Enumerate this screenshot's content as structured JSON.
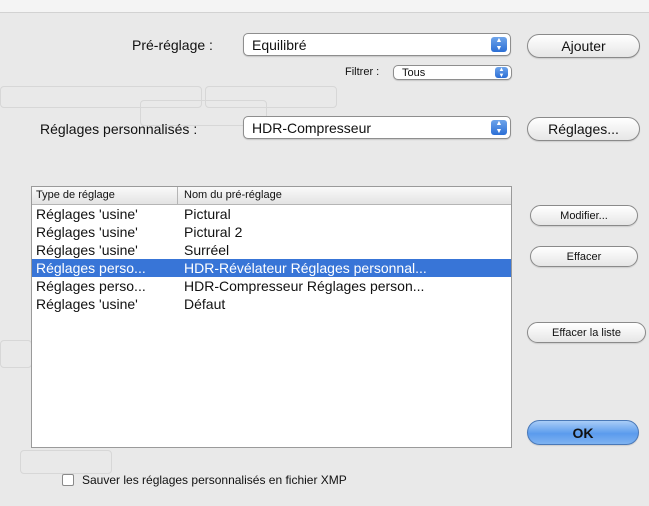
{
  "preset": {
    "label": "Pré-réglage :",
    "value": "Equilibré",
    "add_button": "Ajouter"
  },
  "filter": {
    "label": "Filtrer :",
    "value": "Tous"
  },
  "custom": {
    "label": "Réglages personnalisés :",
    "value": "HDR-Compresseur",
    "settings_button": "Réglages..."
  },
  "table": {
    "col1": "Type de réglage",
    "col2": "Nom du pré-réglage",
    "rows": [
      {
        "type": "Réglages 'usine'",
        "name": "Pictural"
      },
      {
        "type": "Réglages 'usine'",
        "name": "Pictural 2"
      },
      {
        "type": "Réglages 'usine'",
        "name": "Surréel"
      },
      {
        "type": "Réglages perso...",
        "name": "HDR-Révélateur Réglages personnal..."
      },
      {
        "type": "Réglages perso...",
        "name": "HDR-Compresseur Réglages person..."
      },
      {
        "type": "Réglages 'usine'",
        "name": "Défaut"
      }
    ],
    "selected_index": 3
  },
  "buttons": {
    "modify": "Modifier...",
    "delete": "Effacer",
    "clear_list": "Effacer la liste",
    "ok": "OK"
  },
  "xmp_checkbox": {
    "label": "Sauver les réglages personnalisés en fichier XMP",
    "checked": false
  },
  "colors": {
    "selection": "#3875d7",
    "popup_arrow": "#2c6fd6",
    "ok_button": "#5b9bed"
  },
  "icons": [
    "popup-arrows-icon",
    "checkbox-icon"
  ]
}
